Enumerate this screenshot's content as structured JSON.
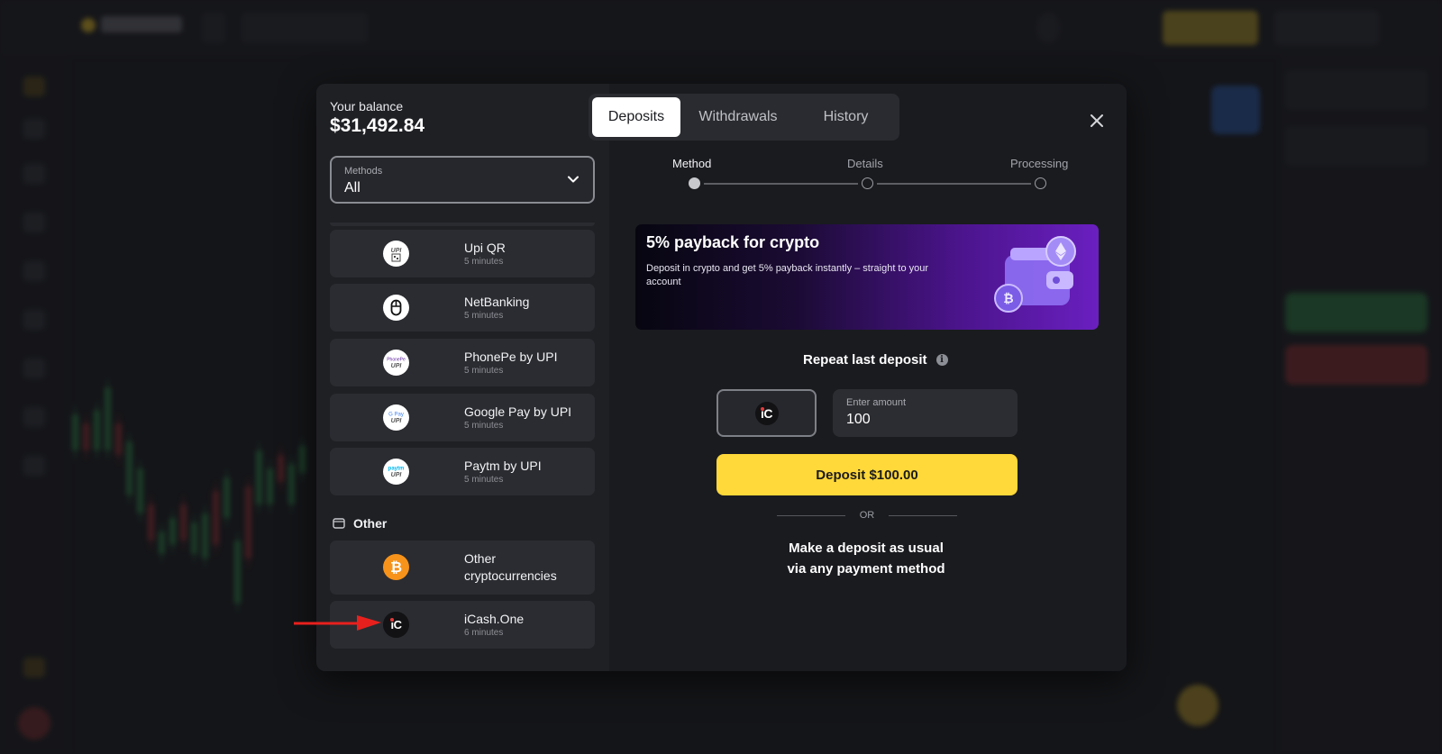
{
  "balance": {
    "label": "Your balance",
    "value": "$31,492.84"
  },
  "tabs": [
    {
      "label": "Deposits",
      "active": true
    },
    {
      "label": "Withdrawals",
      "active": false
    },
    {
      "label": "History",
      "active": false
    }
  ],
  "filter": {
    "label": "Methods",
    "value": "All"
  },
  "methods": [
    {
      "name": "Upi QR",
      "time": "5 minutes",
      "icon": "upi-qr-icon"
    },
    {
      "name": "NetBanking",
      "time": "5 minutes",
      "icon": "mouse-icon"
    },
    {
      "name": "PhonePe by UPI",
      "time": "5 minutes",
      "icon": "phonepe-icon"
    },
    {
      "name": "Google Pay by UPI",
      "time": "5 minutes",
      "icon": "google-pay-icon"
    },
    {
      "name": "Paytm by UPI",
      "time": "5 minutes",
      "icon": "paytm-icon"
    }
  ],
  "other_section": {
    "title": "Other",
    "items": [
      {
        "name_line1": "Other",
        "name_line2": "cryptocurrencies",
        "icon": "bitcoin-icon"
      },
      {
        "name": "iCash.One",
        "time": "6 minutes",
        "icon": "icash-icon"
      }
    ]
  },
  "steps": [
    {
      "label": "Method",
      "active": true
    },
    {
      "label": "Details",
      "active": false
    },
    {
      "label": "Processing",
      "active": false
    }
  ],
  "promo": {
    "title": "5% payback for crypto",
    "text": "Deposit in crypto and get 5% payback instantly – straight to your account"
  },
  "repeat": {
    "title": "Repeat last deposit",
    "amount_label": "Enter amount",
    "amount_value": "100",
    "deposit_button": "Deposit $100.00",
    "or": "OR",
    "usual_line1": "Make a deposit as usual",
    "usual_line2": "via any payment method"
  },
  "ic_text": "iC",
  "colors": {
    "accent_yellow": "#ffd83a",
    "promo_purple": "#6a1fc0",
    "annotation_red": "#e8201d",
    "bitcoin_orange": "#f7931a"
  }
}
